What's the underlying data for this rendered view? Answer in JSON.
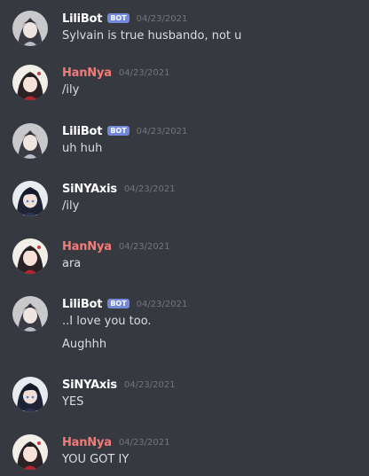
{
  "colors": {
    "background": "#36393f",
    "bot_name": "#ffffff",
    "hannya_name": "#f47b78",
    "sinyaxis_name": "#ffffff",
    "timestamp": "#72767d",
    "message_text": "#dcddde",
    "bot_tag": "#7289da"
  },
  "messages": [
    {
      "author": "LiliBot",
      "bot_tag": "BOT",
      "timestamp": "04/23/2021",
      "lines": [
        "Sylvain is true husbando, not u"
      ]
    },
    {
      "author": "HanNya",
      "timestamp": "04/23/2021",
      "lines": [
        "/ily"
      ]
    },
    {
      "author": "LiliBot",
      "bot_tag": "BOT",
      "timestamp": "04/23/2021",
      "lines": [
        "uh huh"
      ]
    },
    {
      "author": "SiNYAxis",
      "timestamp": "04/23/2021",
      "lines": [
        "/ily"
      ]
    },
    {
      "author": "HanNya",
      "timestamp": "04/23/2021",
      "lines": [
        "ara"
      ]
    },
    {
      "author": "LiliBot",
      "bot_tag": "BOT",
      "timestamp": "04/23/2021",
      "lines": [
        "..I love you too.",
        "Aughhh"
      ]
    },
    {
      "author": "SiNYAxis",
      "timestamp": "04/23/2021",
      "lines": [
        "YES"
      ]
    },
    {
      "author": "HanNya",
      "timestamp": "04/23/2021",
      "lines": [
        "YOU GOT IY"
      ]
    }
  ]
}
